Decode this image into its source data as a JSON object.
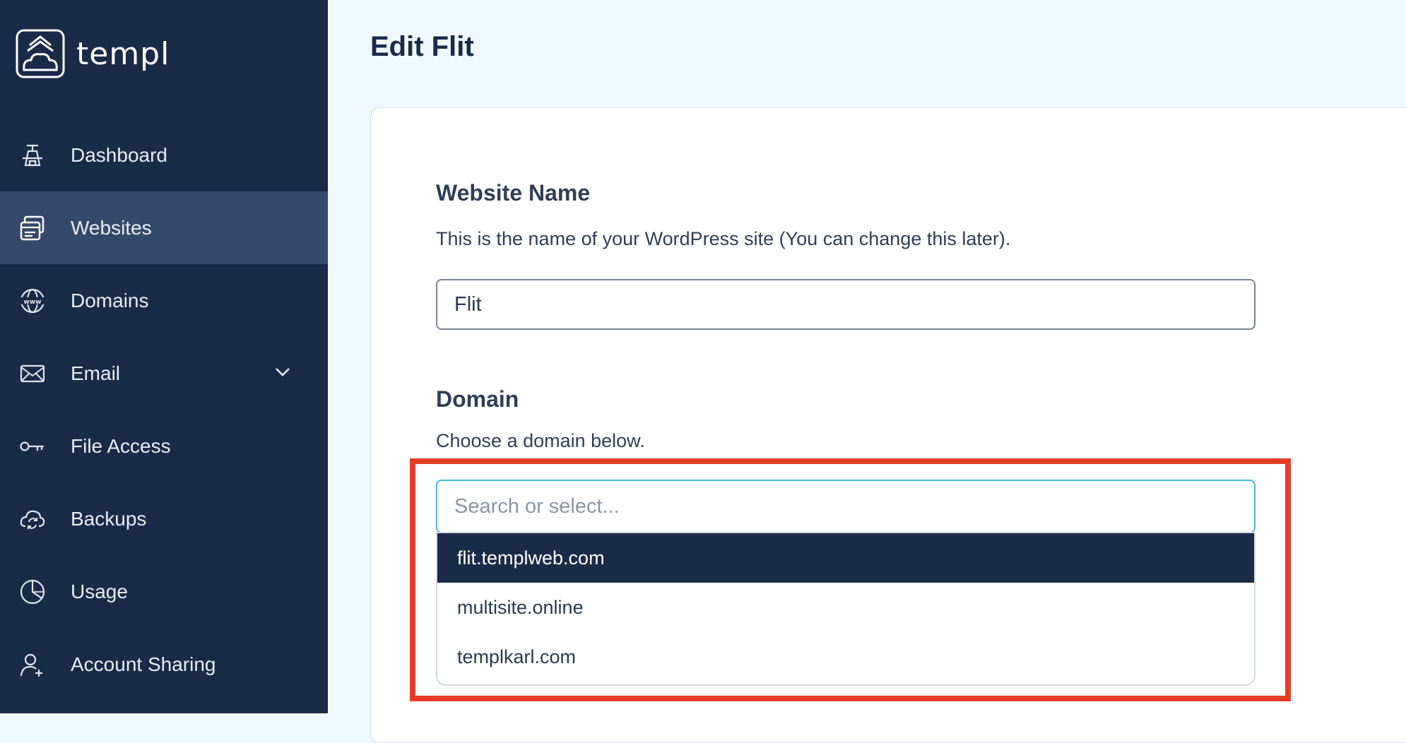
{
  "brand": {
    "name": "templ"
  },
  "sidebar": {
    "items": [
      {
        "label": "Dashboard",
        "icon": "dashboard-icon",
        "active": false
      },
      {
        "label": "Websites",
        "icon": "websites-icon",
        "active": true
      },
      {
        "label": "Domains",
        "icon": "globe-www-icon",
        "active": false
      },
      {
        "label": "Email",
        "icon": "envelope-icon",
        "active": false,
        "expandable": true
      },
      {
        "label": "File Access",
        "icon": "key-icon",
        "active": false
      },
      {
        "label": "Backups",
        "icon": "cloud-sync-icon",
        "active": false
      },
      {
        "label": "Usage",
        "icon": "pie-chart-icon",
        "active": false
      },
      {
        "label": "Account Sharing",
        "icon": "add-user-icon",
        "active": false
      }
    ]
  },
  "page": {
    "title": "Edit Flit"
  },
  "form": {
    "website_name": {
      "title": "Website Name",
      "description": "This is the name of your WordPress site (You can change this later).",
      "value": "Flit"
    },
    "domain": {
      "title": "Domain",
      "description": "Choose a domain below.",
      "placeholder": "Search or select...",
      "options": [
        "flit.templweb.com",
        "multisite.online",
        "templkarl.com"
      ],
      "highlighted_option": "flit.templweb.com"
    }
  },
  "colors": {
    "sidebar_bg": "#1a2b48",
    "sidebar_active_bg": "#37496a",
    "page_bg": "#eef8fd",
    "focus_border": "#4ab6df",
    "annotation_red": "#e43d26"
  }
}
